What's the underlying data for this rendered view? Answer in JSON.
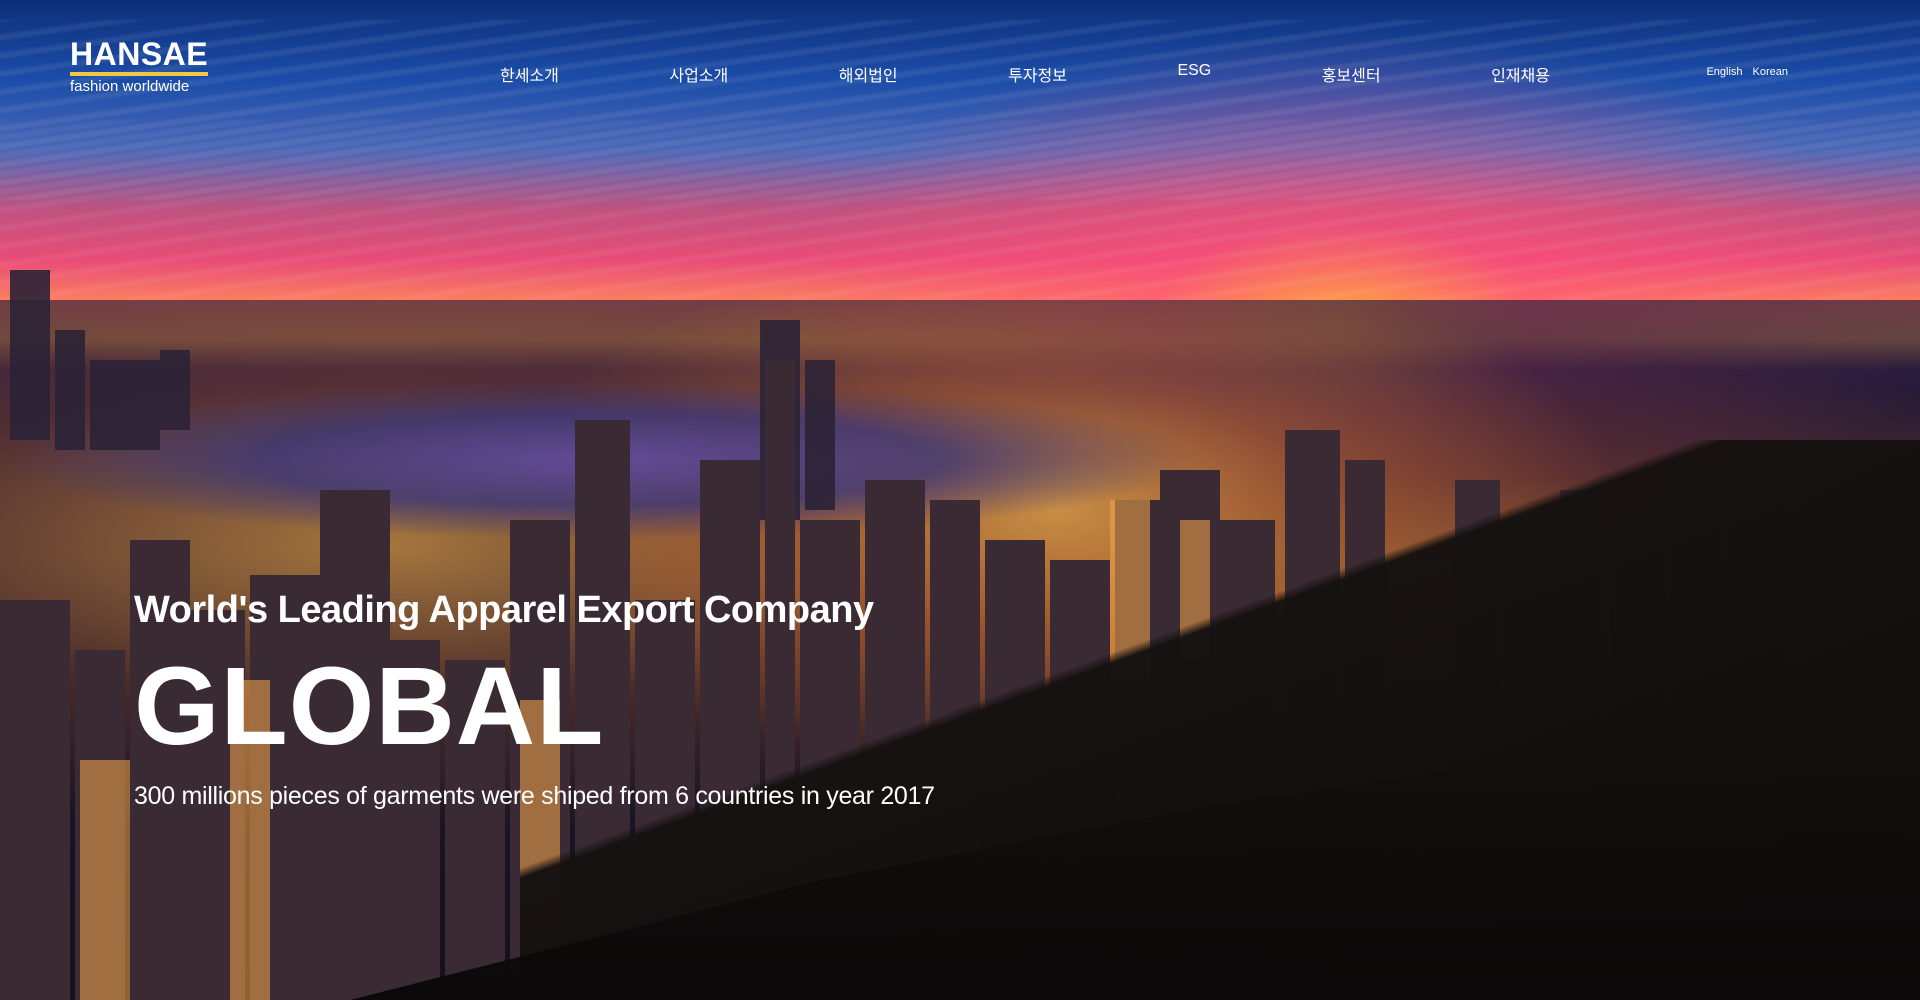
{
  "header": {
    "logo": {
      "title": "HANSAE",
      "subtitle": "fashion worldwide"
    },
    "nav": [
      {
        "label": "한세소개"
      },
      {
        "label": "사업소개"
      },
      {
        "label": "해외법인"
      },
      {
        "label": "투자정보"
      },
      {
        "label": "ESG"
      },
      {
        "label": "홍보센터"
      },
      {
        "label": "인재채용"
      }
    ],
    "lang": {
      "english": "English",
      "korean": "Korean"
    }
  },
  "hero": {
    "tagline": "World's Leading Apparel Export Company",
    "headline": "GLOBAL",
    "stat": "300 millions pieces of garments were shiped from 6 countries in year 2017"
  },
  "colors": {
    "accent": "#f2c744",
    "text": "#ffffff"
  }
}
